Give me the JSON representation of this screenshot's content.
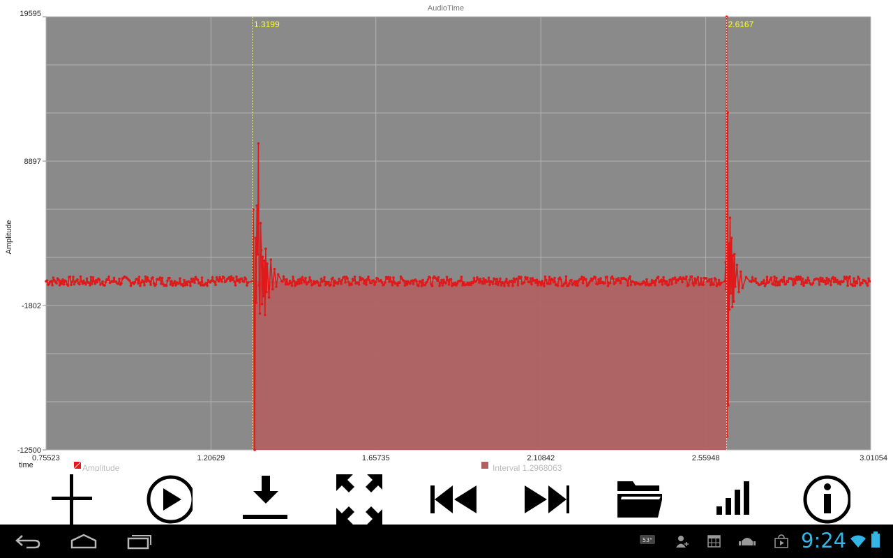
{
  "chart_data": {
    "type": "line",
    "title": "AudioTime",
    "xlabel": "time",
    "ylabel": "Amplitude",
    "xlim": [
      0.75523,
      3.01054
    ],
    "ylim": [
      -12500,
      19595
    ],
    "x_ticks": [
      "0.75523",
      "1.20629",
      "1.65735",
      "2.10842",
      "2.55948",
      "3.01054"
    ],
    "y_ticks": [
      "19595",
      "8897",
      "-1802",
      "-12500"
    ],
    "grid": true,
    "series": [
      {
        "name": "Amplitude",
        "color": "#e0191b",
        "baseline": 0,
        "noise_amplitude": 350,
        "points": [
          [
            1.3199,
            0
          ],
          [
            1.322,
            5300
          ],
          [
            1.324,
            -1500
          ],
          [
            1.326,
            -12500
          ],
          [
            1.328,
            3200
          ],
          [
            1.33,
            -1600
          ],
          [
            1.332,
            5600
          ],
          [
            1.334,
            2000
          ],
          [
            1.336,
            10200
          ],
          [
            1.338,
            -300
          ],
          [
            1.34,
            -2400
          ],
          [
            1.342,
            4300
          ],
          [
            1.344,
            2300
          ],
          [
            1.346,
            -1700
          ],
          [
            1.348,
            1800
          ],
          [
            1.35,
            -1100
          ],
          [
            1.352,
            1500
          ],
          [
            1.354,
            -2500
          ],
          [
            1.356,
            2400
          ],
          [
            1.358,
            -800
          ],
          [
            1.36,
            1300
          ],
          [
            1.365,
            -1200
          ],
          [
            1.37,
            1600
          ],
          [
            1.375,
            -600
          ],
          [
            1.38,
            900
          ],
          [
            1.385,
            -400
          ],
          [
            1.39,
            500
          ],
          [
            1.4,
            0
          ],
          [
            2.612,
            0
          ],
          [
            2.614,
            1400
          ],
          [
            2.615,
            -600
          ],
          [
            2.6167,
            19595
          ],
          [
            2.618,
            -11500
          ],
          [
            2.6195,
            12500
          ],
          [
            2.621,
            -9200
          ],
          [
            2.6225,
            2800
          ],
          [
            2.624,
            -2100
          ],
          [
            2.626,
            4700
          ],
          [
            2.628,
            -900
          ],
          [
            2.63,
            3200
          ],
          [
            2.632,
            -1900
          ],
          [
            2.634,
            1900
          ],
          [
            2.636,
            -1500
          ],
          [
            2.638,
            2000
          ],
          [
            2.64,
            -400
          ],
          [
            2.645,
            1200
          ],
          [
            2.65,
            -800
          ],
          [
            2.655,
            700
          ],
          [
            2.66,
            -500
          ],
          [
            2.67,
            300
          ],
          [
            2.68,
            0
          ]
        ]
      }
    ],
    "markers": [
      {
        "x": 1.3199,
        "label": "1.3199",
        "color": "#ffff33"
      },
      {
        "x": 2.6167,
        "label": "2.6167",
        "color": "#ffff33"
      }
    ],
    "interval": {
      "from": 1.3199,
      "to": 2.6167,
      "label": "Interval 1.2968063",
      "color": "#b06262"
    },
    "legend": [
      {
        "label": "Amplitude",
        "color": "#e0191b"
      },
      {
        "label": "Interval 1.2968063",
        "color": "#b06262"
      }
    ],
    "legend_position": "bottom",
    "plot_background": "#8a8a8a"
  },
  "toolbar": {
    "buttons": [
      {
        "name": "add",
        "icon": "plus-icon"
      },
      {
        "name": "play",
        "icon": "play-icon"
      },
      {
        "name": "download",
        "icon": "download-icon"
      },
      {
        "name": "fit",
        "icon": "expand-arrows-icon"
      },
      {
        "name": "rewind",
        "icon": "skip-back-icon"
      },
      {
        "name": "forward",
        "icon": "skip-forward-icon"
      },
      {
        "name": "open",
        "icon": "folder-icon"
      },
      {
        "name": "levels",
        "icon": "signal-bars-icon"
      },
      {
        "name": "info",
        "icon": "info-icon"
      }
    ]
  },
  "system_bar": {
    "clock": "9:24",
    "weather_temp": "53°",
    "accent_color": "#33b5e5"
  }
}
